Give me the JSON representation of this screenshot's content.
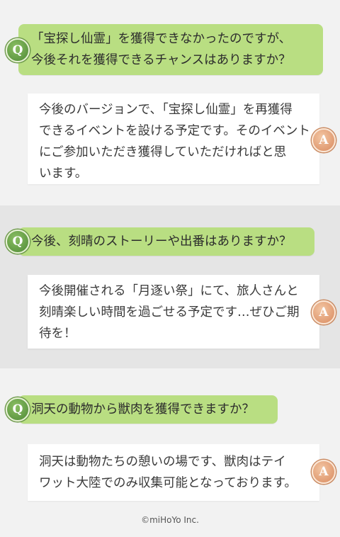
{
  "qa": [
    {
      "q_badge": "Q",
      "question_lines": [
        "「宝探し仙霊」を獲得できなかったのですが、",
        "今後それを獲得できるチャンスはありますか？"
      ],
      "a_badge": "A",
      "answer_lines": [
        "今後のバージョンで、「宝探し仙霊」を再獲得",
        "できるイベントを設ける予定です。そのイベント",
        "にご参加いただき獲得していただければと思",
        "います。"
      ]
    },
    {
      "q_badge": "Q",
      "question_lines": [
        "今後、刻晴のストーリーや出番はありますか？"
      ],
      "a_badge": "A",
      "answer_lines": [
        "今後開催される「月逐い祭」にて、旅人さんと",
        "刻晴楽しい時間を過ごせる予定です…ぜひご期",
        "待を！"
      ]
    },
    {
      "q_badge": "Q",
      "question_lines": [
        "洞天の動物から獣肉を獲得できますか？"
      ],
      "a_badge": "A",
      "answer_lines": [
        "洞天は動物たちの憩いの場です、獣肉はテイ",
        "ワット大陸でのみ収集可能となっております。"
      ]
    }
  ],
  "footer": "©miHoYo Inc."
}
